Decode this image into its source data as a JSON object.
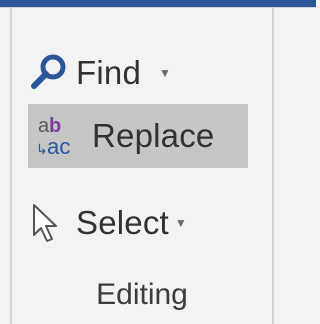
{
  "ribbon": {
    "accent_color": "#2b579a",
    "group": {
      "label": "Editing",
      "items": [
        {
          "label": "Find",
          "icon": "magnifier-icon",
          "has_dropdown": true
        },
        {
          "label": "Replace",
          "icon": "replace-ab-ac-icon",
          "selected": true
        },
        {
          "label": "Select",
          "icon": "cursor-arrow-icon",
          "has_dropdown": true
        }
      ]
    }
  }
}
